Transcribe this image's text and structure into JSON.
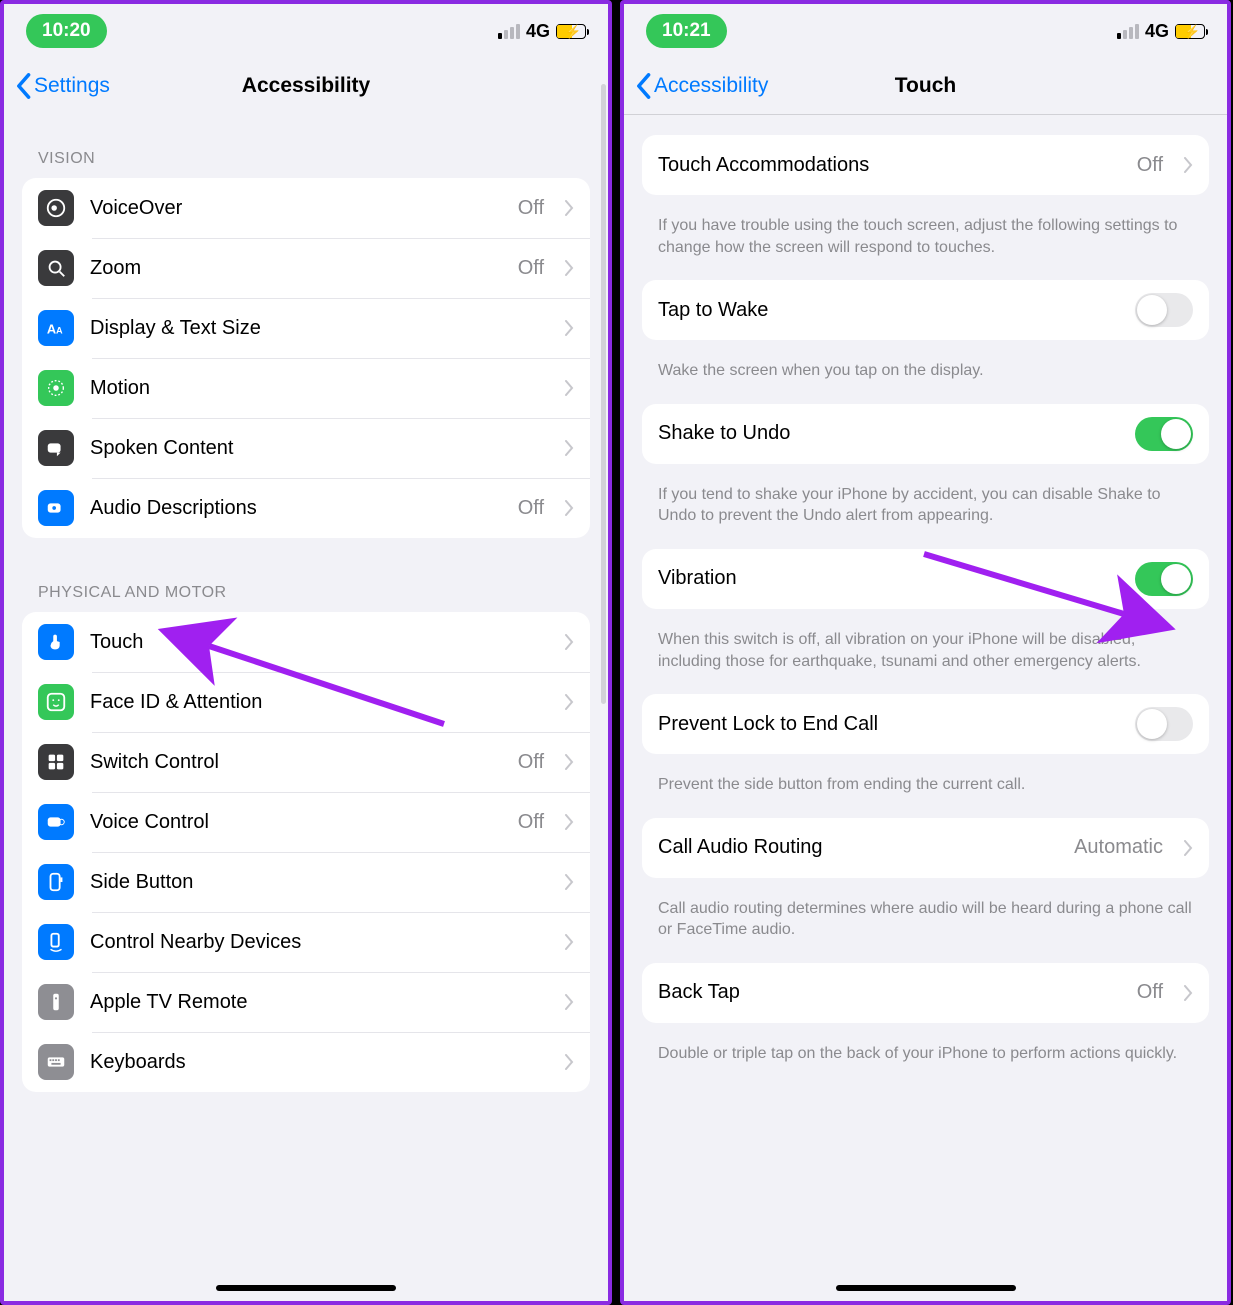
{
  "leftPhone": {
    "status": {
      "time": "10:20",
      "network": "4G"
    },
    "nav": {
      "back": "Settings",
      "title": "Accessibility"
    },
    "visionHeader": "Vision",
    "vision": [
      {
        "label": "VoiceOver",
        "detail": "Off",
        "iconName": "voiceover-icon",
        "bg": "#3a3a3c"
      },
      {
        "label": "Zoom",
        "detail": "Off",
        "iconName": "zoom-icon",
        "bg": "#3a3a3c"
      },
      {
        "label": "Display & Text Size",
        "detail": "",
        "iconName": "textsize-icon",
        "bg": "#007aff"
      },
      {
        "label": "Motion",
        "detail": "",
        "iconName": "motion-icon",
        "bg": "#34c759"
      },
      {
        "label": "Spoken Content",
        "detail": "",
        "iconName": "spoken-icon",
        "bg": "#3a3a3c"
      },
      {
        "label": "Audio Descriptions",
        "detail": "Off",
        "iconName": "audiodesc-icon",
        "bg": "#007aff"
      }
    ],
    "pmHeader": "Physical and Motor",
    "pm": [
      {
        "label": "Touch",
        "detail": "",
        "iconName": "touch-icon",
        "bg": "#007aff"
      },
      {
        "label": "Face ID & Attention",
        "detail": "",
        "iconName": "faceid-icon",
        "bg": "#34c759"
      },
      {
        "label": "Switch Control",
        "detail": "Off",
        "iconName": "switch-icon",
        "bg": "#3a3a3c"
      },
      {
        "label": "Voice Control",
        "detail": "Off",
        "iconName": "voicecontrol-icon",
        "bg": "#007aff"
      },
      {
        "label": "Side Button",
        "detail": "",
        "iconName": "sidebutton-icon",
        "bg": "#007aff"
      },
      {
        "label": "Control Nearby Devices",
        "detail": "",
        "iconName": "nearby-icon",
        "bg": "#007aff"
      },
      {
        "label": "Apple TV Remote",
        "detail": "",
        "iconName": "tvremote-icon",
        "bg": "#8e8e93"
      },
      {
        "label": "Keyboards",
        "detail": "",
        "iconName": "keyboards-icon",
        "bg": "#8e8e93"
      }
    ]
  },
  "rightPhone": {
    "status": {
      "time": "10:21",
      "network": "4G"
    },
    "nav": {
      "back": "Accessibility",
      "title": "Touch"
    },
    "items": {
      "touchAcc": {
        "label": "Touch Accommodations",
        "detail": "Off"
      },
      "touchAccFooter": "If you have trouble using the touch screen, adjust the following settings to change how the screen will respond to touches.",
      "tapWake": {
        "label": "Tap to Wake",
        "on": false
      },
      "tapWakeFooter": "Wake the screen when you tap on the display.",
      "shake": {
        "label": "Shake to Undo",
        "on": true
      },
      "shakeFooter": "If you tend to shake your iPhone by accident, you can disable Shake to Undo to prevent the Undo alert from appearing.",
      "vibration": {
        "label": "Vibration",
        "on": true
      },
      "vibrationFooter": "When this switch is off, all vibration on your iPhone will be disabled, including those for earthquake, tsunami and other emergency alerts.",
      "preventLock": {
        "label": "Prevent Lock to End Call",
        "on": false
      },
      "preventLockFooter": "Prevent the side button from ending the current call.",
      "callAudio": {
        "label": "Call Audio Routing",
        "detail": "Automatic"
      },
      "callAudioFooter": "Call audio routing determines where audio will be heard during a phone call or FaceTime audio.",
      "backTap": {
        "label": "Back Tap",
        "detail": "Off"
      },
      "backTapFooter": "Double or triple tap on the back of your iPhone to perform actions quickly."
    }
  }
}
